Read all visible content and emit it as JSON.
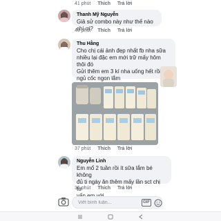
{
  "comments": [
    {
      "author": "",
      "text": "",
      "meta": {
        "time": "41 phút",
        "like": "Thích",
        "reply": "Trả lời"
      }
    },
    {
      "author": "Thanh Mỹ Nguyễn",
      "text": "Giả sử combo này như  thế nào chị ơi?",
      "meta": {
        "time": "40 phút",
        "like": "Thích",
        "reply": "Trả lời"
      }
    },
    {
      "author": "Thu Hằng",
      "text": "Cho chị cái ảnh đẹp nhất fb nha sữa\nnhiều lại đặc em mới trữ mấy hôm\nthôi đó\nGửi thêm em 3 kí nha uống hết rồi chị\nngủ cốc ngon lắm",
      "meta": {
        "time": "37 phút",
        "like": "Thích",
        "reply": "Trả lời"
      }
    },
    {
      "author": "Nguyễn Linh",
      "text": "Em mổ 2 tuần rồi ít sữa lắm bé không\nđủ ti ngày ăn thêm mấy lần sct chị tư\nvấn em với",
      "meta": {
        "time": "36 phút",
        "like": "Thích",
        "reply": "Trả lời"
      }
    }
  ],
  "composer": {
    "placeholder": "Viết bình luận...",
    "gif_label": "GIF"
  },
  "icons": [
    "avatar-female",
    "avatar-female",
    "avatar-female",
    "camera-icon",
    "gif-icon",
    "emoji-icon",
    "menu-icon",
    "home-icon",
    "back-icon"
  ],
  "colors": {
    "bubble": "#f0f2f5",
    "meta_text": "#65676b",
    "author_text": "#050505"
  }
}
